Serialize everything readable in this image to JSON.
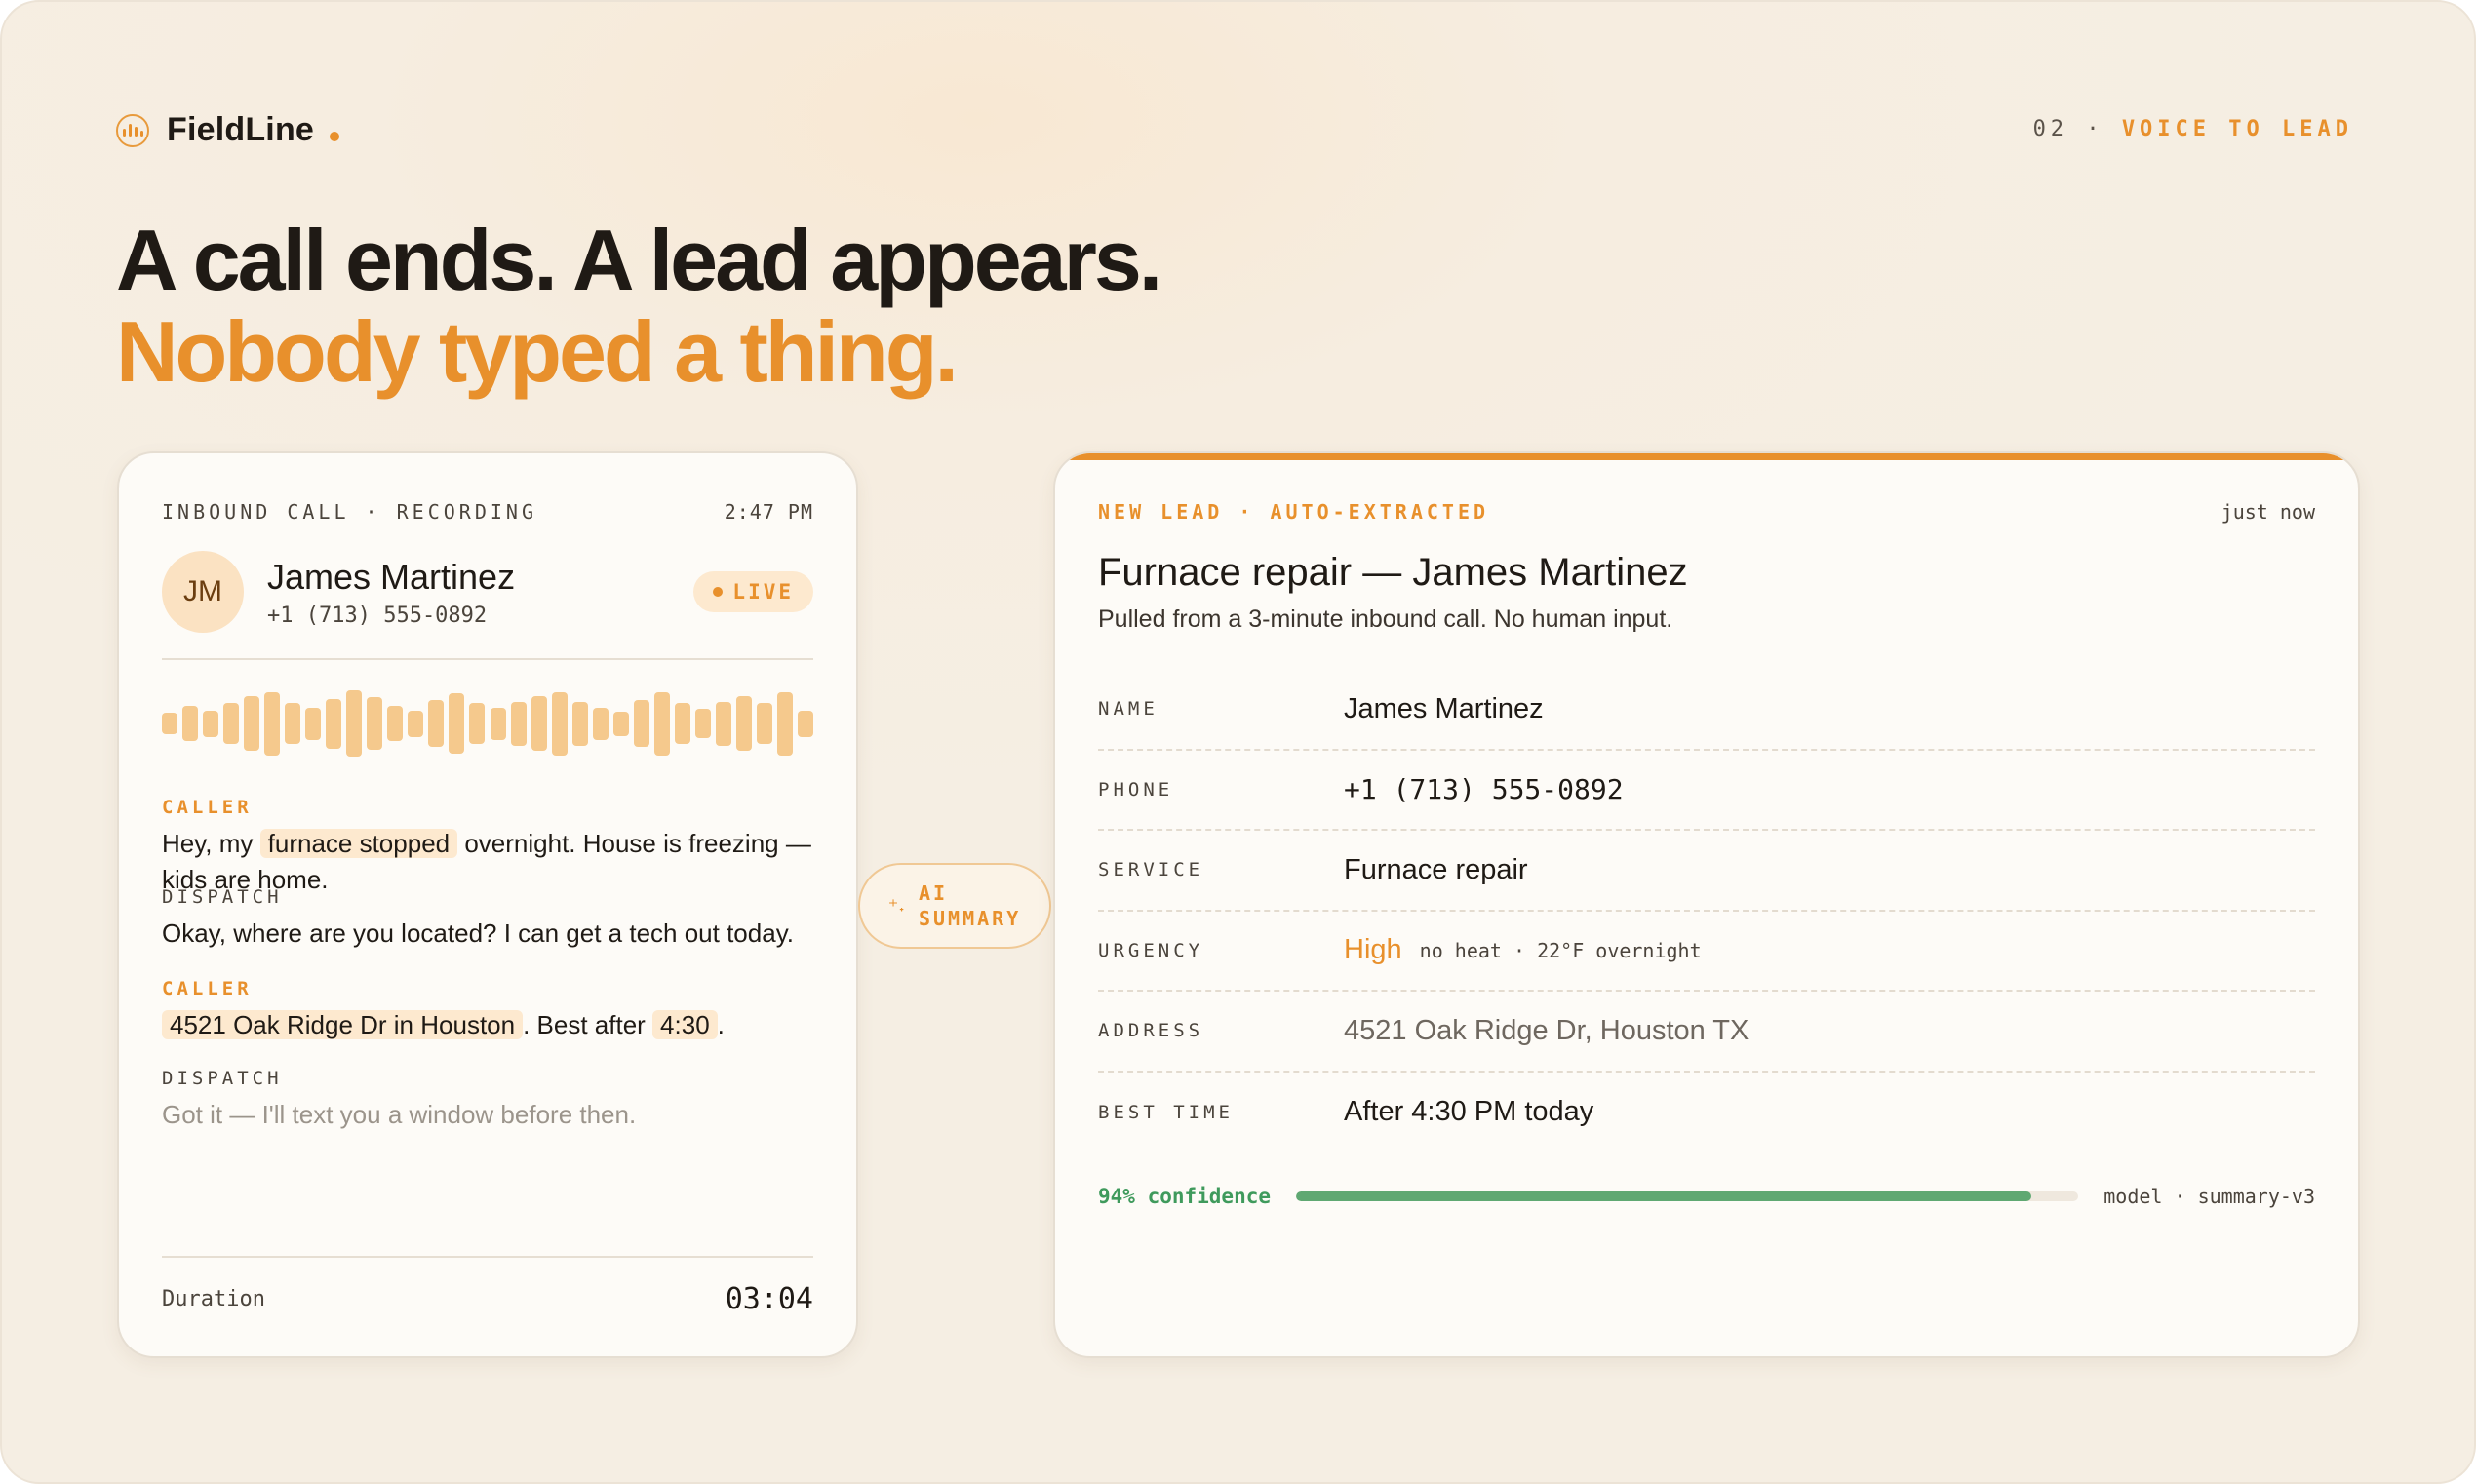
{
  "brand": {
    "name": "FieldLine",
    "icon": "soundwave-icon"
  },
  "section": {
    "number": "02",
    "separator": "·",
    "label": "VOICE TO LEAD"
  },
  "headline": {
    "line1": "A call ends. A lead appears.",
    "line2": "Nobody typed a thing."
  },
  "call": {
    "header_label": "INBOUND CALL · RECORDING",
    "time": "2:47 PM",
    "avatar_initials": "JM",
    "caller_name": "James Martinez",
    "caller_phone": "+1 (713) 555-0892",
    "status": "LIVE",
    "waveform_levels": [
      0.2,
      0.45,
      0.3,
      0.55,
      0.8,
      0.95,
      0.55,
      0.4,
      0.7,
      1.0,
      0.75,
      0.45,
      0.3,
      0.65,
      0.9,
      0.55,
      0.4,
      0.6,
      0.8,
      0.95,
      0.6,
      0.4,
      0.25,
      0.65,
      0.95,
      0.55,
      0.35,
      0.6,
      0.8,
      0.55,
      0.95,
      0.3
    ],
    "transcript": [
      {
        "speaker": "CALLER",
        "role": "caller",
        "parts": [
          {
            "text": "Hey, my "
          },
          {
            "text": "furnace stopped",
            "hl": true
          },
          {
            "text": " overnight. House is freezing — kids are home."
          }
        ]
      },
      {
        "speaker": "DISPATCH",
        "role": "dispatch",
        "parts": [
          {
            "text": "Okay, where are you located? I can get a tech out today."
          }
        ]
      },
      {
        "speaker": "CALLER",
        "role": "caller",
        "parts": [
          {
            "text": "4521 Oak Ridge Dr in Houston",
            "hl": true
          },
          {
            "text": ". Best after "
          },
          {
            "text": "4:30",
            "hl": true
          },
          {
            "text": "."
          }
        ]
      },
      {
        "speaker": "DISPATCH",
        "role": "dispatch",
        "faded": true,
        "parts": [
          {
            "text": "Got it — I'll text you a window before then."
          }
        ]
      }
    ],
    "duration_label": "Duration",
    "duration_value": "03:04"
  },
  "connector": {
    "line1": "AI",
    "line2": "SUMMARY",
    "icon": "sparkle-icon"
  },
  "lead": {
    "tag": "NEW LEAD · AUTO-EXTRACTED",
    "when": "just now",
    "title": "Furnace repair — James Martinez",
    "subtitle": "Pulled from a 3-minute inbound call. No human input.",
    "fields": [
      {
        "label": "NAME",
        "value": "James Martinez"
      },
      {
        "label": "PHONE",
        "value": "+1 (713) 555-0892",
        "style": "mono"
      },
      {
        "label": "SERVICE",
        "value": "Furnace repair"
      },
      {
        "label": "URGENCY",
        "value": "High",
        "style": "urgent",
        "note": "no heat · 22°F overnight"
      },
      {
        "label": "ADDRESS",
        "value": "4521 Oak Ridge Dr, Houston TX",
        "style": "muted"
      },
      {
        "label": "BEST TIME",
        "value": "After 4:30 PM today"
      }
    ],
    "confidence_text": "94% confidence",
    "confidence_fraction": 0.94,
    "model_text": "model · summary-v3"
  },
  "colors": {
    "accent": "#e8902c",
    "success": "#5fa872",
    "ink": "#1f1a15",
    "background": "#f5eee3"
  }
}
